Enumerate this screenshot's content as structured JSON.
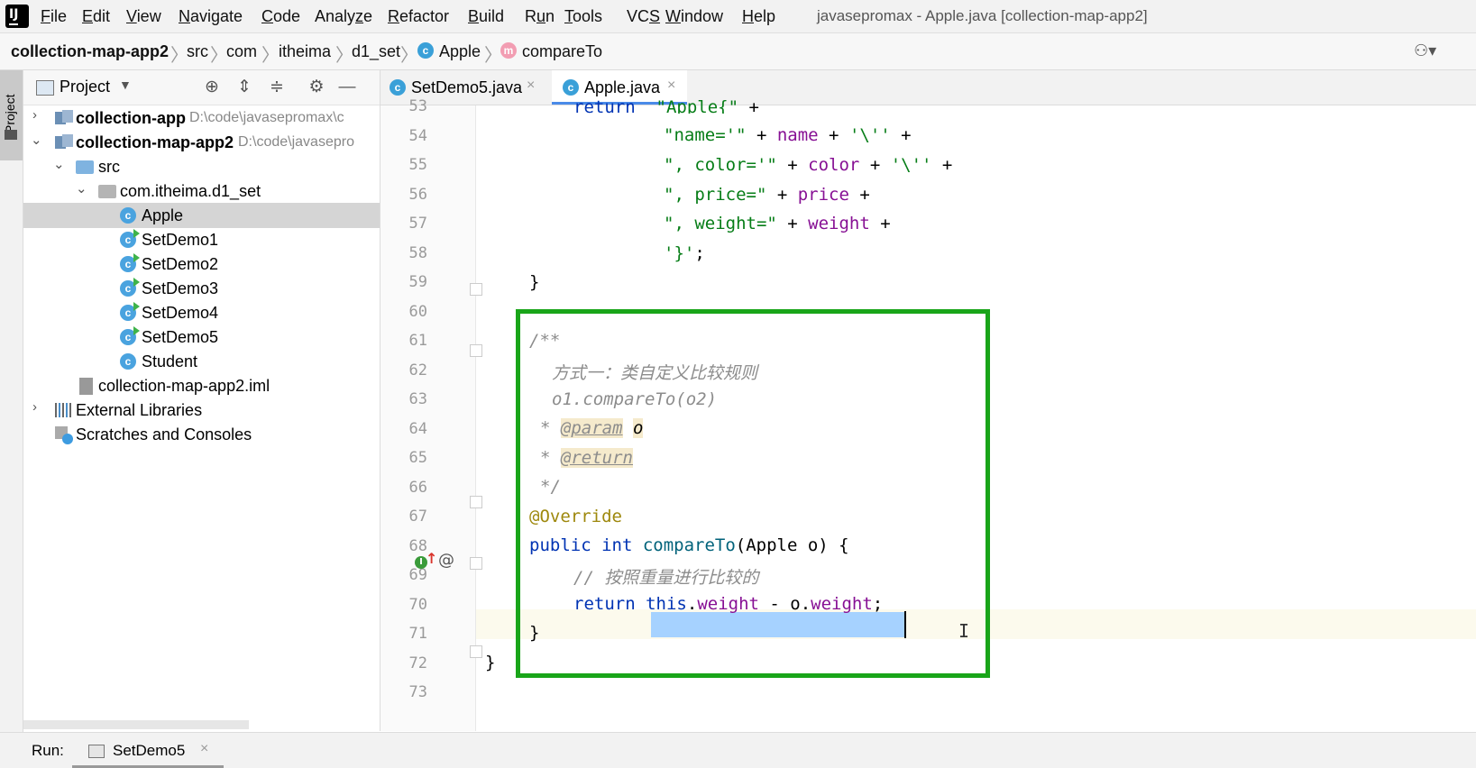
{
  "app": {
    "window_title": "javasepromax - Apple.java [collection-map-app2]"
  },
  "menu": [
    {
      "pre": "",
      "u": "F",
      "post": "ile"
    },
    {
      "pre": "",
      "u": "E",
      "post": "dit"
    },
    {
      "pre": "",
      "u": "V",
      "post": "iew"
    },
    {
      "pre": "",
      "u": "N",
      "post": "avigate"
    },
    {
      "pre": "",
      "u": "C",
      "post": "ode"
    },
    {
      "pre": "Analy",
      "u": "z",
      "post": "e"
    },
    {
      "pre": "",
      "u": "R",
      "post": "efactor"
    },
    {
      "pre": "",
      "u": "B",
      "post": "uild"
    },
    {
      "pre": "R",
      "u": "u",
      "post": "n"
    },
    {
      "pre": "",
      "u": "T",
      "post": "ools"
    },
    {
      "pre": "VC",
      "u": "S",
      "post": ""
    },
    {
      "pre": "",
      "u": "W",
      "post": "indow"
    },
    {
      "pre": "",
      "u": "H",
      "post": "elp"
    }
  ],
  "breadcrumb": {
    "project": "collection-map-app2",
    "parts": [
      "src",
      "com",
      "itheima",
      "d1_set"
    ],
    "class_badge": "c",
    "class": "Apple",
    "method_badge": "m",
    "method": "compareTo"
  },
  "left_stripe": {
    "project": "Project"
  },
  "project_panel": {
    "title": "Project",
    "tree": [
      {
        "label": "collection-app",
        "path": "D:\\code\\javasepromax\\c",
        "bold": true
      },
      {
        "label": "collection-map-app2",
        "path": "D:\\code\\javasepro",
        "bold": true
      },
      {
        "label": "src"
      },
      {
        "label": "com.itheima.d1_set"
      },
      {
        "label": "Apple",
        "badge": "c"
      },
      {
        "label": "SetDemo1",
        "badge": "c"
      },
      {
        "label": "SetDemo2",
        "badge": "c"
      },
      {
        "label": "SetDemo3",
        "badge": "c"
      },
      {
        "label": "SetDemo4",
        "badge": "c"
      },
      {
        "label": "SetDemo5",
        "badge": "c"
      },
      {
        "label": "Student",
        "badge": "c"
      },
      {
        "label": "collection-map-app2.iml"
      },
      {
        "label": "External Libraries"
      },
      {
        "label": "Scratches and Consoles"
      }
    ]
  },
  "tabs": [
    {
      "label": "SetDemo5.java",
      "badge": "c",
      "close": "×"
    },
    {
      "label": "Apple.java",
      "badge": "c",
      "close": "×"
    }
  ],
  "editor": {
    "line_numbers": [
      "53",
      "54",
      "55",
      "56",
      "57",
      "58",
      "59",
      "60",
      "61",
      "62",
      "63",
      "64",
      "65",
      "66",
      "67",
      "68",
      "69",
      "70",
      "71",
      "72",
      "73"
    ],
    "code": {
      "l53_kw": "return",
      "l53_str": "\"Apple{\"",
      "l53_op": " +",
      "l54_str": "\"name='\"",
      "l54_p": " + ",
      "l54_fld": "name",
      "l54_p2": " + ",
      "l54_str2": "'\\''",
      "l54_p3": " +",
      "l55_str": "\", color='\"",
      "l55_p": " + ",
      "l55_fld": "color",
      "l55_p2": " + ",
      "l55_str2": "'\\''",
      "l55_p3": " +",
      "l56_str": "\", price=\"",
      "l56_p": " + ",
      "l56_fld": "price",
      "l56_p2": " +",
      "l57_str": "\", weight=\"",
      "l57_p": " + ",
      "l57_fld": "weight",
      "l57_p2": " +",
      "l58_str": "'}'",
      "l58_p": ";",
      "l59": "}",
      "l61": "/**",
      "l62": "方式一：类自定义比较规则",
      "l63": "o1.compareTo(o2)",
      "l64_star": "* ",
      "l64_tag": "@param",
      "l64_sp": " ",
      "l64_name": "o",
      "l65_star": "* ",
      "l65_tag": "@return",
      "l66": "*/",
      "l67": "@Override",
      "l68_kw": "public int",
      "l68_sp": " ",
      "l68_fn": "compareTo",
      "l68_rest": "(Apple o) {",
      "l69": "// 按照重量进行比较的",
      "l70_kw": "return",
      "l70_sp": " ",
      "l70_this": "this",
      "l70_dot": ".",
      "l70_fld": "weight",
      "l70_mid": " - o.",
      "l70_fld2": "weight",
      "l70_end": ";",
      "l71": "}",
      "l72": "}"
    },
    "gutter_marks": {
      "override": "I",
      "arrow": "↑",
      "at": "@"
    }
  },
  "bottom": {
    "run_label": "Run:",
    "run_config": "SetDemo5",
    "close": "×"
  },
  "colors": {
    "highlight_box": "#19a519",
    "selection": "#a6d2ff",
    "keyword": "#0033b3",
    "string": "#067d17",
    "field": "#871094"
  }
}
